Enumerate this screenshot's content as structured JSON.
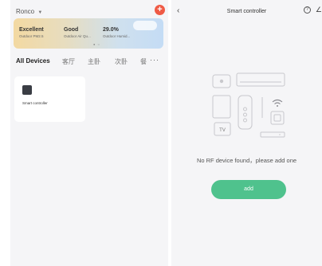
{
  "left": {
    "home_name": "Ronco",
    "caret": "▼",
    "add_icon": "plus-icon",
    "weather": [
      {
        "value": "Excellent",
        "label": "Outdoor PM2.5"
      },
      {
        "value": "Good",
        "label": "Outdoor Air Qu..."
      },
      {
        "value": "29.0%",
        "label": "Outdoor Humid..."
      }
    ],
    "tabs": [
      "All Devices",
      "客厅",
      "主卧",
      "次卧",
      "餐"
    ],
    "more": "···",
    "devices": [
      {
        "name": "Smart controller"
      }
    ]
  },
  "right": {
    "back": "‹",
    "title": "Smart controller",
    "help": "?",
    "edit": "∠",
    "tv_label": "TV",
    "empty_message": "No RF device found，please add one",
    "add_button": "add"
  },
  "colors": {
    "add_red": "#ef5a45",
    "accent_green": "#4fc28d",
    "panel_bg": "#f5f5f7"
  }
}
